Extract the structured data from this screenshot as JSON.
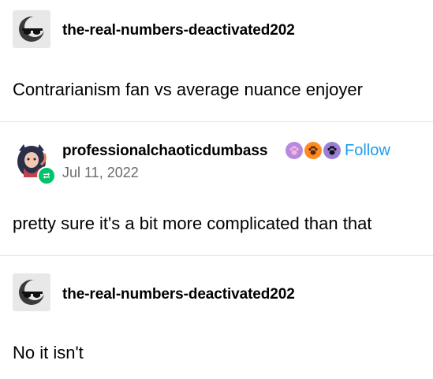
{
  "posts": [
    {
      "username": "the-real-numbers-deactivated202",
      "text": "Contrarianism fan vs average nuance enjoyer"
    },
    {
      "username": "professionalchaoticdumbass",
      "date": "Jul 11, 2022",
      "follow_label": "Follow",
      "text": "pretty sure it's a bit more complicated than that"
    },
    {
      "username": "the-real-numbers-deactivated202",
      "text": "No it isn't"
    }
  ],
  "colors": {
    "follow": "#1e9bf0",
    "reblog_badge": "#00c46a",
    "divider": "#e2e2e2",
    "date": "#6b6b6b"
  },
  "icons": [
    "sunglasses-moon-avatar-icon",
    "catgirl-avatar-icon",
    "reblog-icon",
    "paw-badge-icon",
    "paw-badge-icon",
    "paw-badge-icon"
  ]
}
